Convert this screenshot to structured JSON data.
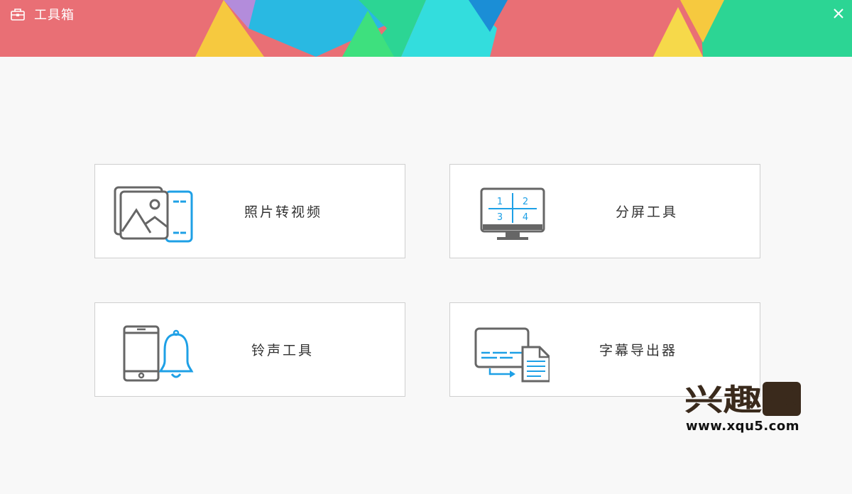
{
  "window": {
    "title": "工具箱",
    "close_symbol": "✕",
    "title_icon": "toolbox-icon",
    "colors": {
      "red": "#e96f75",
      "blue": "#29b9e2",
      "green": "#2cd594",
      "cyan": "#33dddd",
      "yellow": "#f6c93f",
      "purple": "#b38cdb",
      "background": "#f8f8f8",
      "icon_blue": "#1ea0e6",
      "icon_gray": "#666666"
    }
  },
  "tools": [
    {
      "label": "照片转视频",
      "icon": "photo-to-video-icon"
    },
    {
      "label": "分屏工具",
      "icon": "split-screen-icon",
      "screen_numbers": [
        "1",
        "2",
        "3",
        "4"
      ]
    },
    {
      "label": "铃声工具",
      "icon": "ringtone-icon"
    },
    {
      "label": "字幕导出器",
      "icon": "subtitle-export-icon"
    }
  ],
  "watermark": {
    "logo_text": "兴趣屋",
    "url": "www.xqu5.com"
  }
}
